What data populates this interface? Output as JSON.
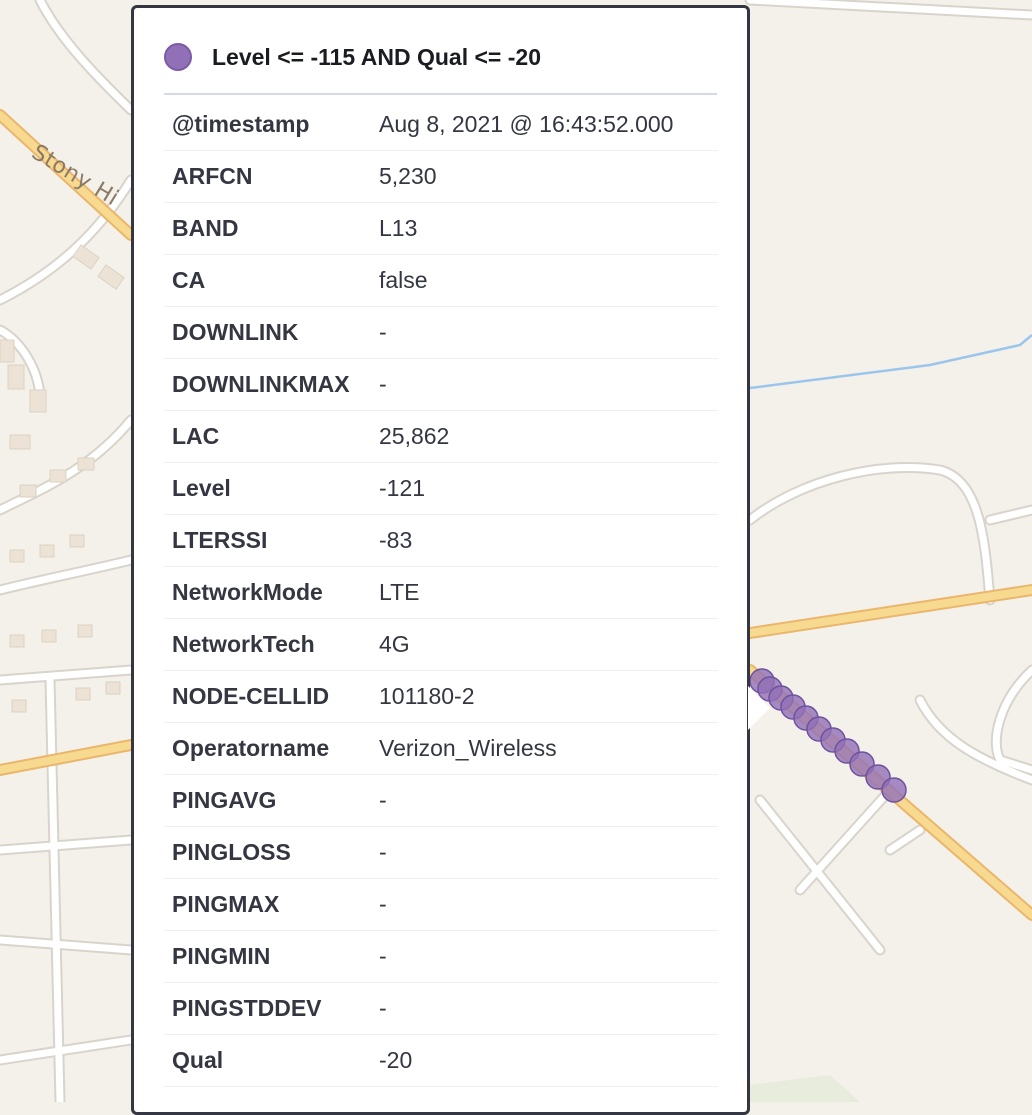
{
  "map": {
    "street_label": "Stony Hi",
    "marker_color": "#9170b8",
    "road_color": "#f7d98f",
    "water_color": "#9cc5ec"
  },
  "popup": {
    "title": "Level <= -115 AND Qual <= -20",
    "legend_color": "#9170b8",
    "rows": [
      {
        "key": "@timestamp",
        "value": "Aug 8, 2021 @ 16:43:52.000"
      },
      {
        "key": "ARFCN",
        "value": "5,230"
      },
      {
        "key": "BAND",
        "value": "L13"
      },
      {
        "key": "CA",
        "value": "false"
      },
      {
        "key": "DOWNLINK",
        "value": "-"
      },
      {
        "key": "DOWNLINKMAX",
        "value": "-"
      },
      {
        "key": "LAC",
        "value": "25,862"
      },
      {
        "key": "Level",
        "value": "-121"
      },
      {
        "key": "LTERSSI",
        "value": "-83"
      },
      {
        "key": "NetworkMode",
        "value": "LTE"
      },
      {
        "key": "NetworkTech",
        "value": "4G"
      },
      {
        "key": "NODE-CELLID",
        "value": "101180-2"
      },
      {
        "key": "Operatorname",
        "value": "Verizon_Wireless"
      },
      {
        "key": "PINGAVG",
        "value": "-"
      },
      {
        "key": "PINGLOSS",
        "value": "-"
      },
      {
        "key": "PINGMAX",
        "value": "-"
      },
      {
        "key": "PINGMIN",
        "value": "-"
      },
      {
        "key": "PINGSTDDEV",
        "value": "-"
      },
      {
        "key": "Qual",
        "value": "-20"
      }
    ]
  }
}
